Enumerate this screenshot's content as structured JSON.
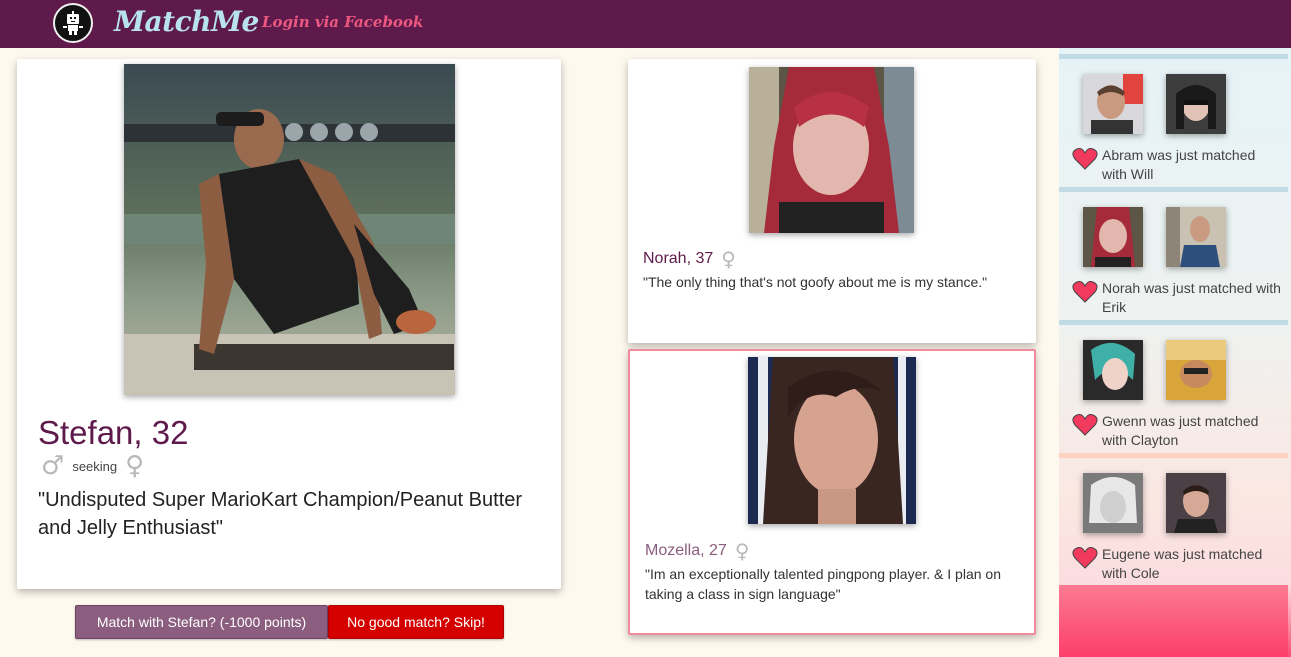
{
  "app": {
    "name": "MatchMe",
    "login_link": "Login via Facebook",
    "logo_icon": "robot-logo-icon"
  },
  "profile": {
    "name_age": "Stefan, 32",
    "gender_symbol": "♂",
    "seeking_label": "seeking",
    "seeking_symbol": "♀",
    "quote": "\"Undisputed Super MarioKart Champion/Peanut Butter and Jelly Enthusiast\""
  },
  "actions": {
    "match_label": "Match with Stefan? (-1000 points)",
    "skip_label": "No good match? Skip!"
  },
  "suggestions": [
    {
      "name_age": "Norah, 37",
      "gender_symbol": "♀",
      "quote": "\"The only thing that's not goofy about me is my stance.\"",
      "selected": false
    },
    {
      "name_age": "Mozella, 27",
      "gender_symbol": "♀",
      "quote": "\"Im an exceptionally talented pingpong player. & I plan on taking a class in sign language\"",
      "selected": true
    }
  ],
  "feed": [
    {
      "text": "Abram was just matched with Will"
    },
    {
      "text": "Norah was just matched with Erik"
    },
    {
      "text": "Gwenn was just matched with Clayton"
    },
    {
      "text": "Eugene was just matched with Cole"
    }
  ],
  "colors": {
    "header": "#5e1a4b",
    "brand": "#b8e2ee",
    "login_link": "#ec5880",
    "name": "#5e1a4b",
    "match_button": "#8b5d7f",
    "skip_button": "#d40000",
    "selected_border": "#f28b9b",
    "heart": "#f23a5e"
  }
}
